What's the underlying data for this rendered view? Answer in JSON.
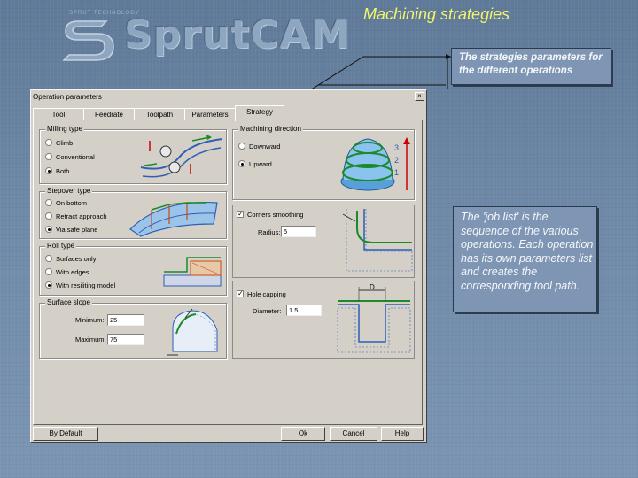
{
  "slide": {
    "title": "Machining strategies",
    "logo_word": "SprutCAM",
    "logo_tag": "SPRUT TECHNOLOGY"
  },
  "callouts": {
    "top": "The strategies parameters for the different operations",
    "bottom": "The 'job list' is the sequence of the various operations. Each operation has its own parameters list and creates the corresponding tool path."
  },
  "dialog": {
    "title": "Operation parameters",
    "close_glyph": "×",
    "tabs": [
      {
        "label": "Tool"
      },
      {
        "label": "Feedrate"
      },
      {
        "label": "Toolpath"
      },
      {
        "label": "Parameters"
      },
      {
        "label": "Strategy"
      }
    ],
    "milling_type": {
      "label": "Milling type",
      "options": [
        {
          "label": "Climb",
          "selected": false
        },
        {
          "label": "Conventional",
          "selected": false
        },
        {
          "label": "Both",
          "selected": true
        }
      ]
    },
    "stepover_type": {
      "label": "Stepover type",
      "options": [
        {
          "label": "On bottom",
          "selected": false
        },
        {
          "label": "Retract approach",
          "selected": false
        },
        {
          "label": "Via safe plane",
          "selected": true
        }
      ]
    },
    "roll_type": {
      "label": "Roll type",
      "options": [
        {
          "label": "Surfaces only",
          "selected": false
        },
        {
          "label": "With edges",
          "selected": false
        },
        {
          "label": "With resiliting model",
          "selected": true
        }
      ]
    },
    "surface_slope": {
      "label": "Surface slope",
      "min_label": "Minimum:",
      "min_value": "25",
      "max_label": "Maximum:",
      "max_value": "75"
    },
    "machining_direction": {
      "label": "Machining direction",
      "options": [
        {
          "label": "Downward",
          "selected": false
        },
        {
          "label": "Upward",
          "selected": true
        }
      ],
      "step_numbers": [
        "3",
        "2",
        "1"
      ]
    },
    "corners_smoothing": {
      "label": "Corners smoothing",
      "checked": true,
      "radius_label": "Radius:",
      "radius_value": "5"
    },
    "hole_capping": {
      "label": "Hole capping",
      "checked": true,
      "diameter_label": "Diameter:",
      "diameter_value": "1.5",
      "marker": "D"
    },
    "buttons": {
      "default": "By Default",
      "ok": "Ok",
      "cancel": "Cancel",
      "help": "Help"
    }
  }
}
